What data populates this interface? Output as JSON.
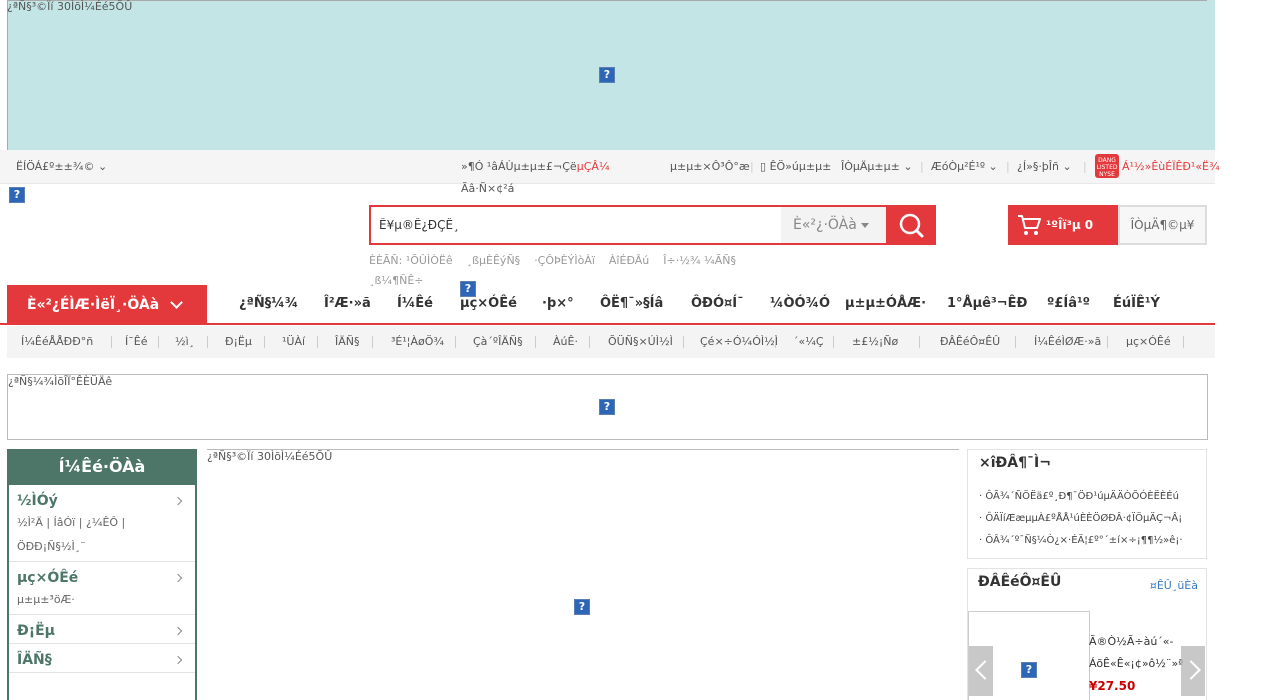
{
  "top_banner": {
    "alt_text": "¿ªÑ§³©Ïí 30ÌõÌ¼Éé5ÕÛ"
  },
  "topbar": {
    "location": "ËÍÖÁ£º±±¾©",
    "welcome": "»¶Ó ¹âÁÙµ±µ±£¬Çë",
    "login": "µÇÂ¼",
    "register": "Ãâ·Ñ×¢²á",
    "my_orders": "µ±µ±×Ô³Ô°æ",
    "mobile": "ÊÖ»úµ±µ±",
    "my_dangdang": "ÎÒµÄµ±µ±",
    "enterprise": "ÆóÒµ²É¹º",
    "service": "¿Í»§·þÎñ",
    "listed": "Á¹½»ÊùÉÏÊÐ¹«Ë¾"
  },
  "search": {
    "placeholder": "Ê¥µ®Ê¿ÐÇÊ¸",
    "category": "È«²¿·ÖÀà",
    "hot_words": [
      "ÈÈÃÑ: ¹ÕÛÌÒËê",
      "¸ßµÈÊýÑ§",
      "·ÇÔÞÈÝÌòÀï",
      "ÀîÉÐÂú",
      "Î÷·½¾ ¼ÃÑ§",
      "¸ß¼¶ÑÊ÷"
    ]
  },
  "cart": {
    "label": "¹ºÎï³µ",
    "count": "0"
  },
  "my_order_btn": "ÎÒµÄ¶©µ¥",
  "nav": {
    "all_categories": "È«²¿ÉÌÆ·ÌëÏ¸·ÖÀà",
    "links": [
      "¿ªÑ§¼¾",
      "Î²Æ·»ã",
      "Í¼Êé",
      "µç×ÓÊé",
      "·þ×°",
      "ÔË¶¯»§Íâ",
      "ÔÐÓ¤Í¯",
      "¼ÒÓ¾Ó",
      "µ±µ±ÓÅÆ·",
      "1°Åµê³¬ÊÐ",
      "º£Íâ¹º",
      "ÉúÏÊ¹Ý"
    ]
  },
  "subnav": [
    "Í¼ÊéÅÅÐÐ°ñ",
    "Í¯Êé",
    "½ì¸",
    "Ð¡Ëµ",
    "¹ÜÀí",
    "ÎÄÑ§",
    "³É¹¦ÀøÖ¾",
    "Çà´ºÎÄÑ§",
    "ÀúÊ·",
    "ÕÜÑ§×ÚÌ½Ì",
    "Çé×÷Ó¼ÓÌ½Ì",
    "´«¼Ç",
    "±£½¡Ñø",
    "ÐÂÊéÔ¤ÊÛ",
    "Í¼ÊéÌØÆ·»ã",
    "µç×ÓÊé"
  ],
  "ad_box": {
    "alt_text": "¿ªÑ§¼¾ÌõÎÏ°ÊÈÜÄê"
  },
  "left_menu": {
    "title": "Í¼Êé·ÖÀà",
    "groups": [
      {
        "title": "½ÌÓý",
        "desc": "½Ì²Ä | ÍâÓï | ¿¼ÊÔ | ÖÐÐ¡Ñ§½Ì¸¨"
      },
      {
        "title": "µç×ÓÊé",
        "desc": "µ±µ±³öÆ·"
      },
      {
        "title": "Ð¡Ëµ",
        "desc": ""
      },
      {
        "title": "ÎÄÑ§",
        "desc": ""
      }
    ]
  },
  "main_slider": {
    "alt_text": "¿ªÑ§³©Ïí 30ÌõÌ¼Éé5ÕÛ"
  },
  "news": {
    "title": "×îÐÂ¶¯Ì¬",
    "items": [
      "ÔÃ¾´ÑÖËä£º¸Ð¶¯ÖÐ¹úµÄÄÒÕÓÈËÈÉú",
      "ÔÄÏíÆæµµÀ£ºÅÅ¹úÈÈÖØÐÂ·¢ÏÖµÄÇ¬Â¡",
      "ÔÂ¾´º¯Ñ§¼Ò¿×·ÉÄ¦£º°´±í×÷¡¶¶½»ê¡·"
    ]
  },
  "promo": {
    "title": "ÐÂÊéÔ¤ÊÛ",
    "more": "¤ÊÛ¸üÈà",
    "desc_lines": [
      "Ã®Ò½Ã÷àú´«-",
      "ÁõÊ«Ê«¡¢»ô½¨»ª"
    ],
    "price": "¥27.50"
  }
}
